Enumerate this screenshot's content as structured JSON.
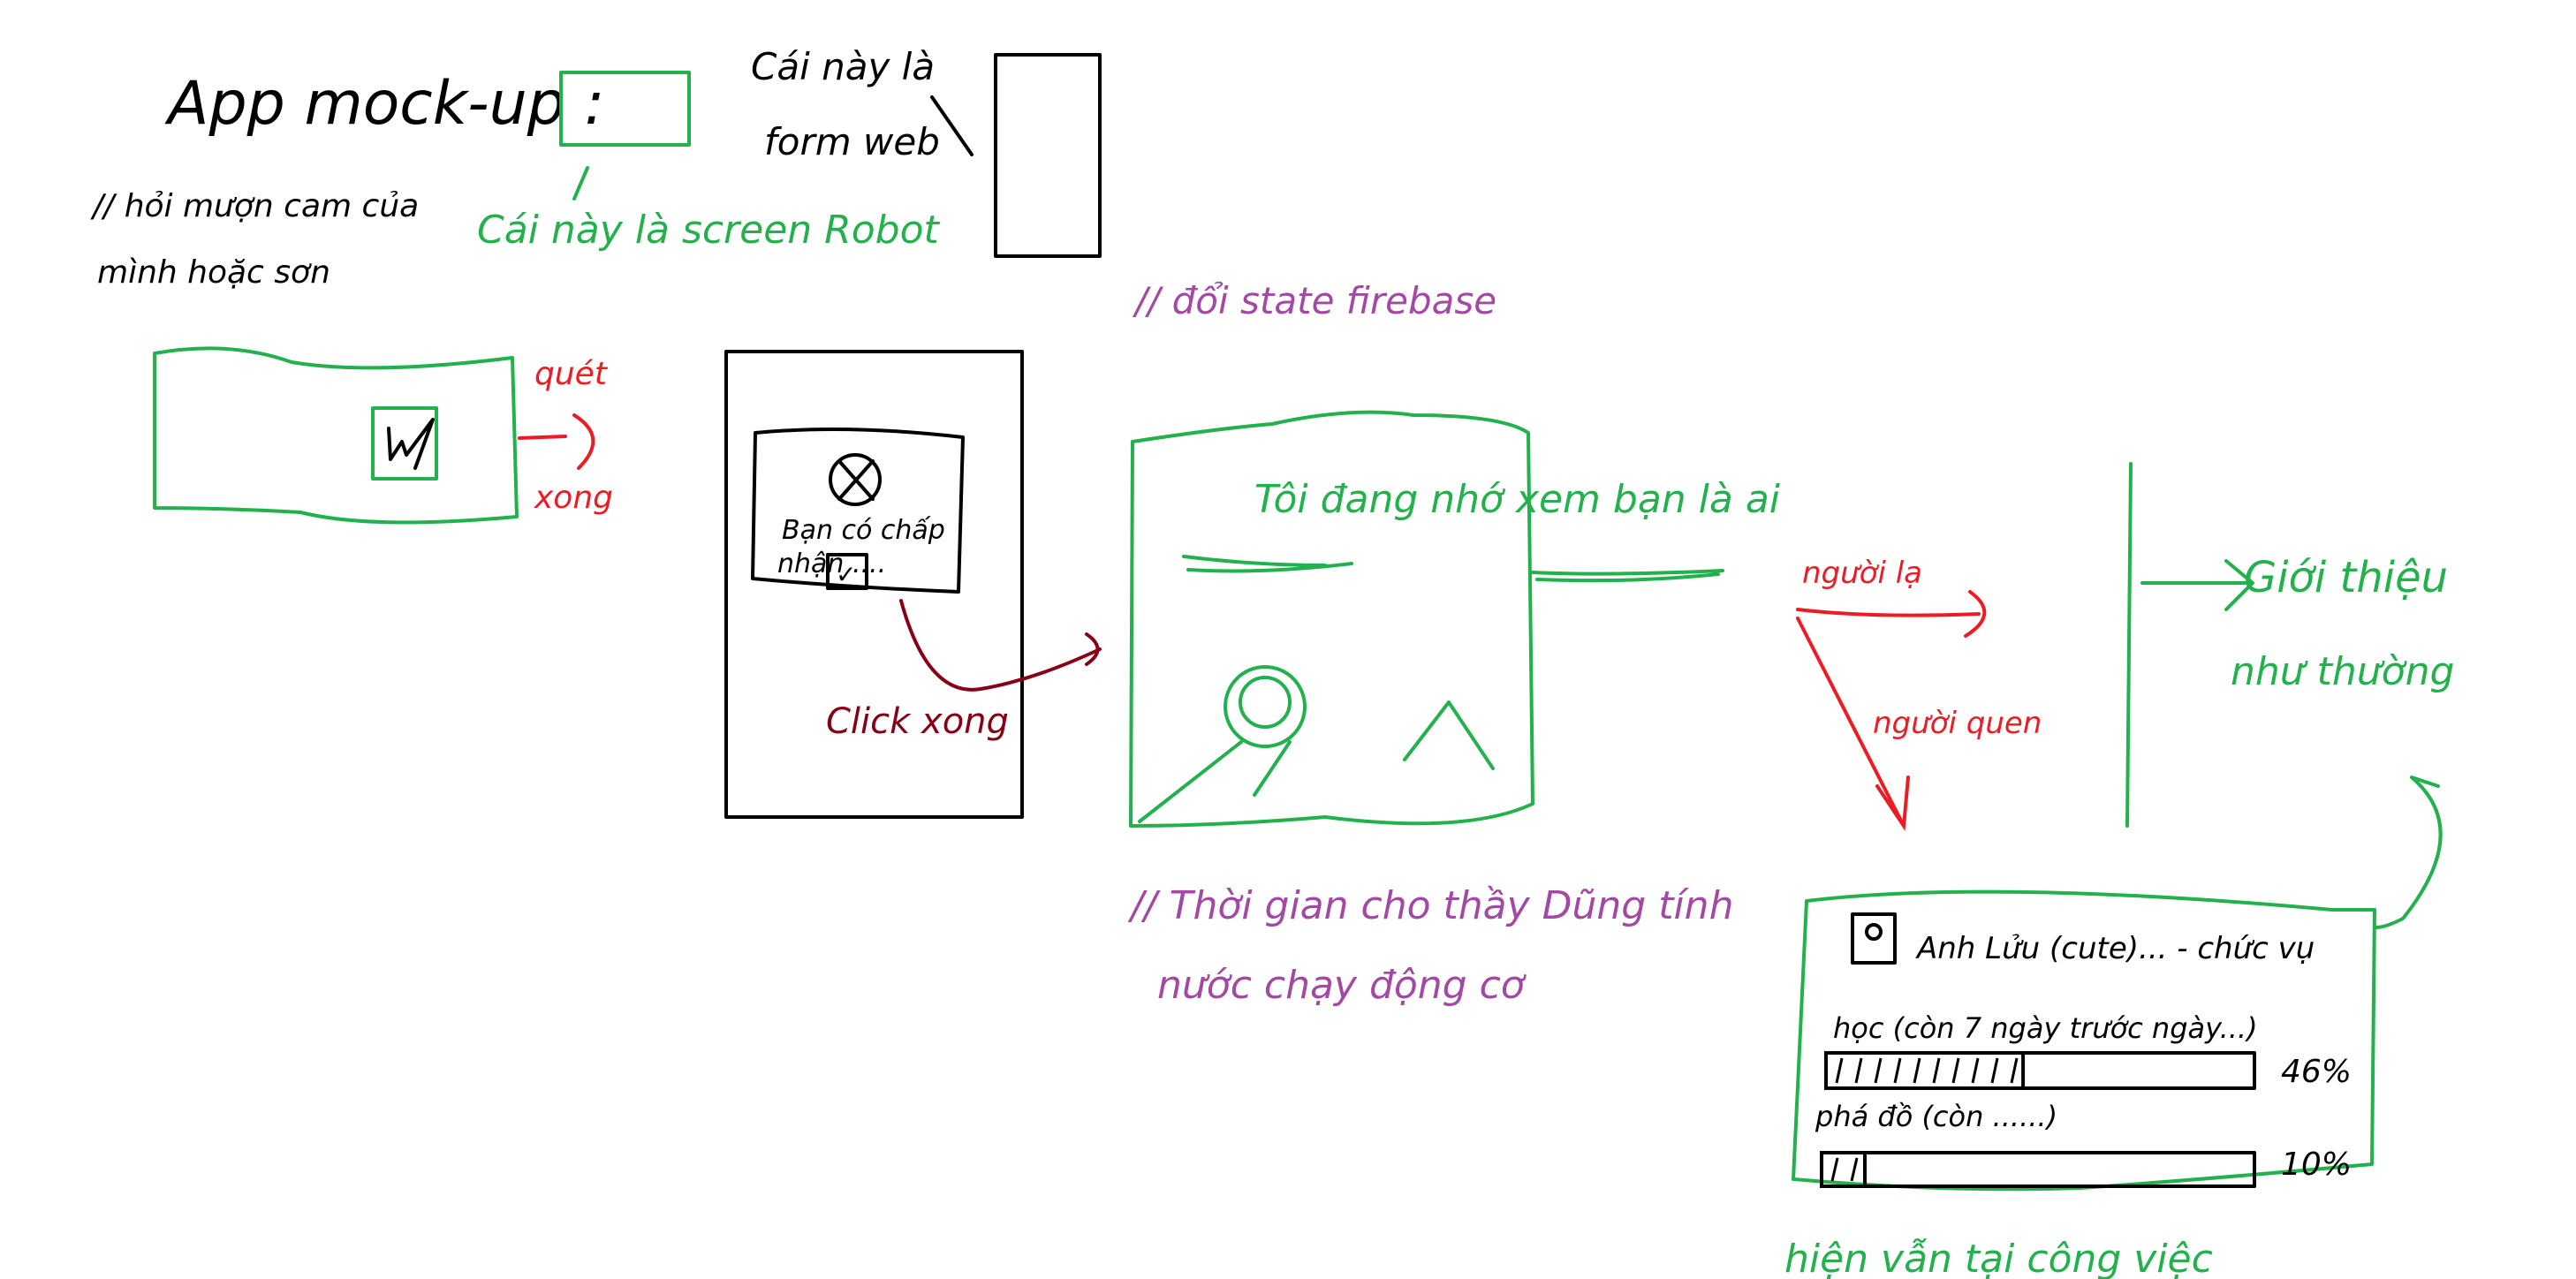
{
  "colors": {
    "ink": "#000000",
    "green": "#22b14c",
    "red": "#ed1c24",
    "dark_red": "#880015",
    "purple": "#a349a4"
  },
  "header": {
    "title": "App mock-up :",
    "note_borrow": [
      "// hỏi mượn cam của",
      "mình hoặc sơn"
    ],
    "robot_label": "Cái này là screen Robot",
    "web_label": [
      "Cái này là",
      "form web"
    ]
  },
  "step1": {
    "scan_label": "quét",
    "done_label": "xong"
  },
  "step2": {
    "dialog_line1": "Bạn có chấp",
    "dialog_line2": "nhận ....",
    "checkbox_mark": "✓",
    "click_label": "Click xong"
  },
  "step3": {
    "note": "// đổi state firebase",
    "screen_text": "Tôi đang nhớ xem bạn là ai",
    "stranger_label": "người lạ",
    "known_label": "người quen",
    "intro_label": [
      "Giới thiệu",
      "như thường"
    ],
    "note_time": [
      "// Thời gian cho thầy Dũng tính",
      "nước chạy động cơ"
    ]
  },
  "profile": {
    "name": "Anh Lửu (cute)... - chức vụ",
    "tasks": [
      {
        "label": "học (còn 7 ngày trước ngày...)",
        "progress": 46,
        "percent_label": "46%"
      },
      {
        "label": "phá đồ (còn ......)",
        "progress": 10,
        "percent_label": "10%"
      }
    ],
    "footer_note": "hiện vẫn tại công việc"
  }
}
